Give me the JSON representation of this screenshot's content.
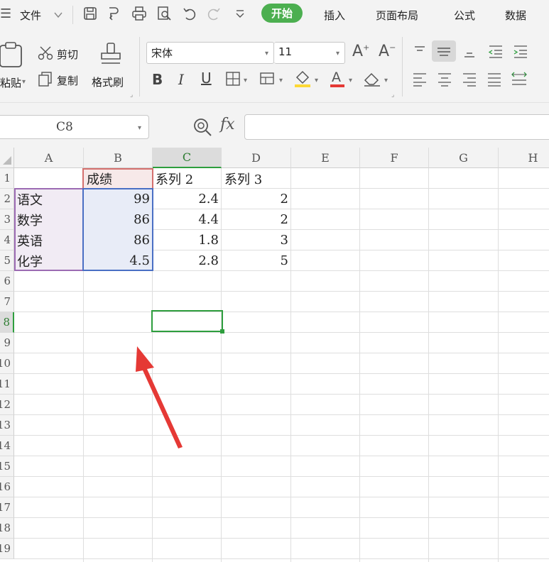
{
  "menu": {
    "file_label": "文件",
    "tabs": [
      "开始",
      "插入",
      "页面布局",
      "公式",
      "数据"
    ],
    "active_tab": "开始"
  },
  "ribbon": {
    "paste_label": "粘贴",
    "cut_label": "剪切",
    "copy_label": "复制",
    "format_painter_label": "格式刷",
    "font_name": "宋体",
    "font_size": "11",
    "underline_color": "#e53935",
    "highlight_color": "#fdd835"
  },
  "formula_bar": {
    "name_box": "C8",
    "fx_label": "fx",
    "formula_value": ""
  },
  "sheet": {
    "columns": [
      "A",
      "B",
      "C",
      "D",
      "E",
      "F",
      "G",
      "H"
    ],
    "rows": [
      "1",
      "2",
      "3",
      "4",
      "5",
      "6",
      "7",
      "8",
      "9",
      "10",
      "11",
      "12",
      "13",
      "14",
      "15",
      "16",
      "17",
      "18",
      "19"
    ],
    "header_row": [
      "",
      "成绩",
      "系列 2",
      "系列 3"
    ],
    "data_rows": [
      [
        "语文",
        "99",
        "2.4",
        "2"
      ],
      [
        "数学",
        "86",
        "4.4",
        "2"
      ],
      [
        "英语",
        "86",
        "1.8",
        "3"
      ],
      [
        "化学",
        "4.5",
        "2.8",
        "5"
      ]
    ],
    "selected_cell": "C8",
    "accent_color": "#2e9e3e",
    "arrow_color": "#e53935"
  }
}
